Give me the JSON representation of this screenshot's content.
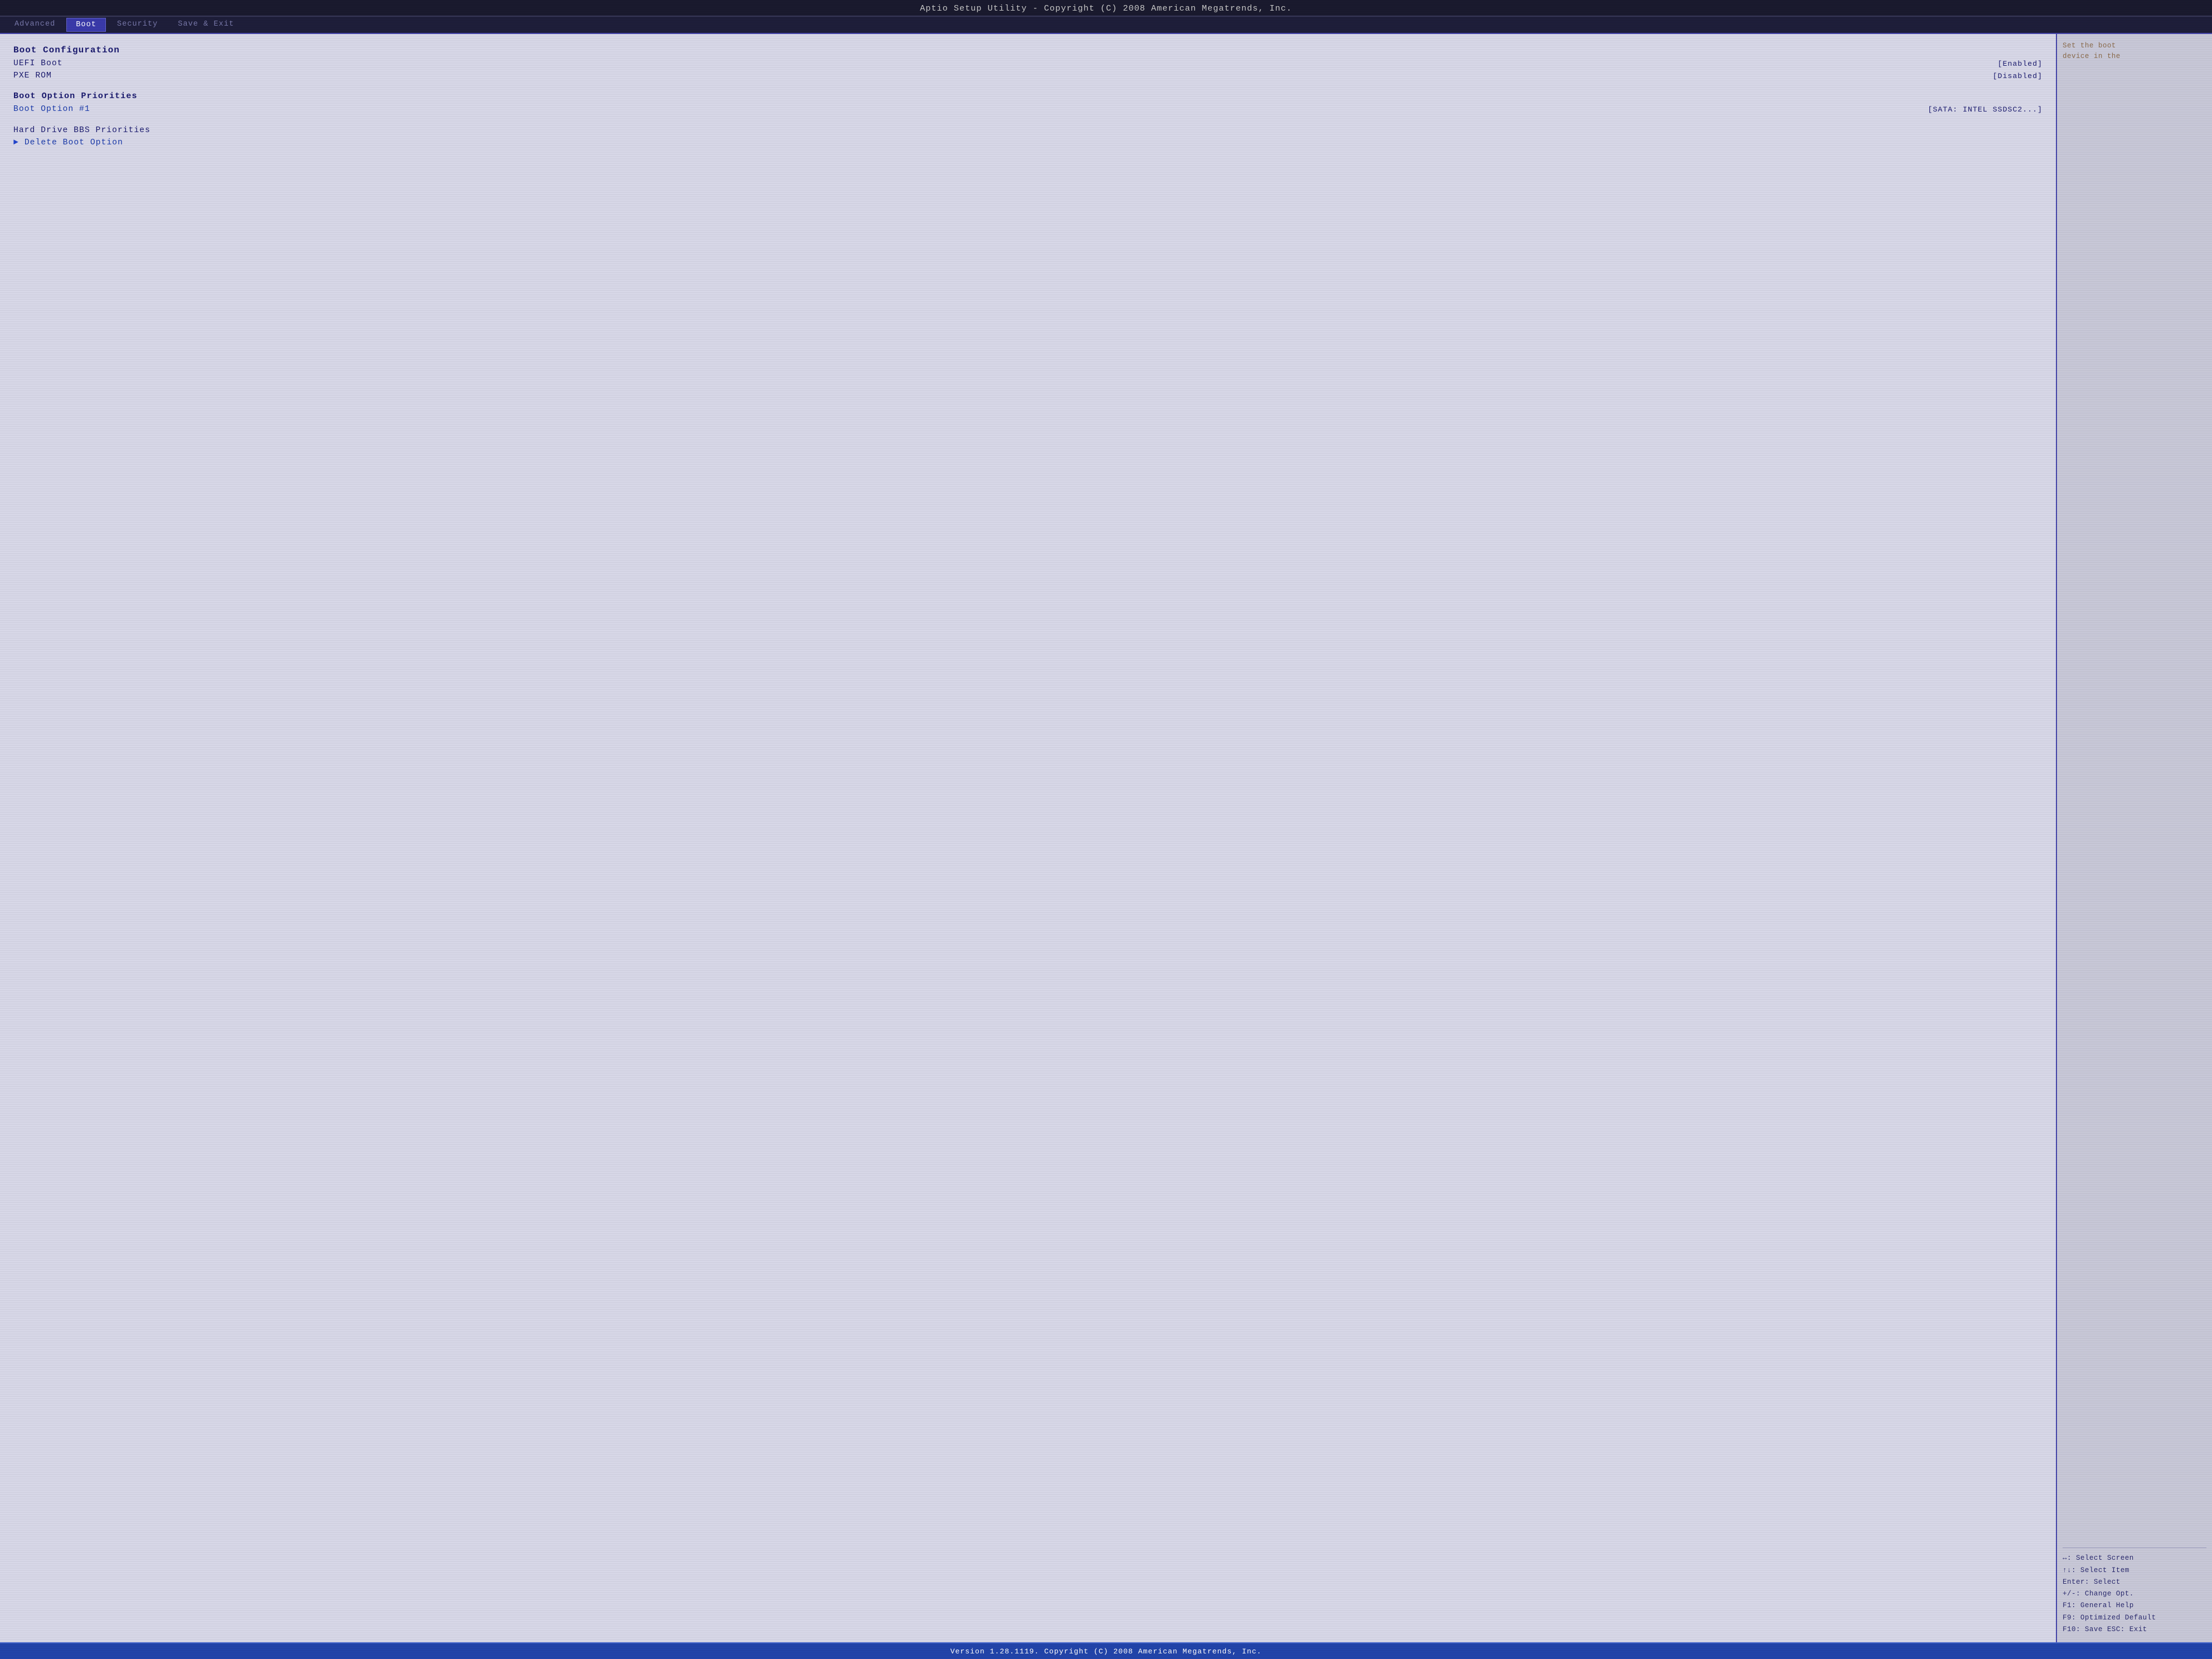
{
  "header": {
    "title": "Aptio Setup Utility - Copyright (C) 2008 American Megatrends, Inc."
  },
  "nav": {
    "tabs": [
      {
        "label": "Advanced",
        "active": false
      },
      {
        "label": "Boot",
        "active": true
      },
      {
        "label": "Security",
        "active": false
      },
      {
        "label": "Save & Exit",
        "active": false
      }
    ]
  },
  "main": {
    "sections": [
      {
        "header": "Boot Configuration",
        "items": [
          {
            "label": "UEFI Boot",
            "value": "[Enabled]",
            "type": "setting"
          },
          {
            "label": "PXE ROM",
            "value": "[Disabled]",
            "type": "setting"
          }
        ]
      },
      {
        "header": "Boot Option Priorities",
        "items": [
          {
            "label": "Boot Option #1",
            "value": "[SATA: INTEL SSDSC2...]",
            "type": "setting",
            "highlighted": true
          }
        ]
      },
      {
        "header": "",
        "items": [
          {
            "label": "Hard Drive BBS Priorities",
            "value": "",
            "type": "submenu"
          },
          {
            "label": "Delete Boot Option",
            "value": "",
            "type": "submenu",
            "arrow": true
          }
        ]
      }
    ]
  },
  "help": {
    "top_text": "Set the boot\ndevice in the",
    "keyboard": [
      "↔: Select Screen",
      "↑↓: Select Item",
      "Enter: Select",
      "+/-: Change Opt.",
      "F1: General Help",
      "F9: Optimized Default",
      "F10: Save  ESC: Exit"
    ]
  },
  "footer": {
    "text": "Version 1.28.1119. Copyright (C) 2008 American Megatrends, Inc."
  }
}
